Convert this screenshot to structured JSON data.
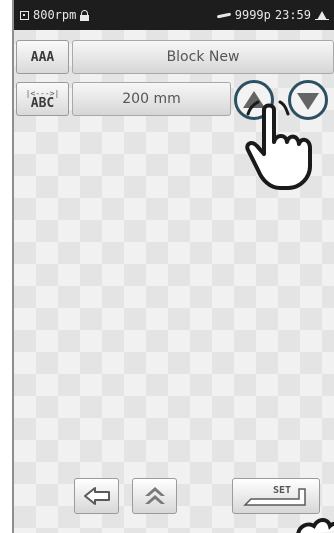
{
  "status_bar": {
    "speed": "800rpm",
    "stitch_count": "9999p",
    "time": "23:59"
  },
  "rows": [
    {
      "tag": "AAA",
      "value": "Block New"
    },
    {
      "tag_top": "|<--->|",
      "tag_bottom": "ABC",
      "value": "200 mm"
    }
  ],
  "buttons": {
    "up_icon": "triangle-up-icon",
    "down_icon": "triangle-down-icon",
    "back_icon": "left-arrow-icon",
    "home_icon": "home-icon",
    "set_label": "SET"
  },
  "colors": {
    "status_bar_bg": "#1d1d1d",
    "highlight_ring": "#2c5063"
  }
}
